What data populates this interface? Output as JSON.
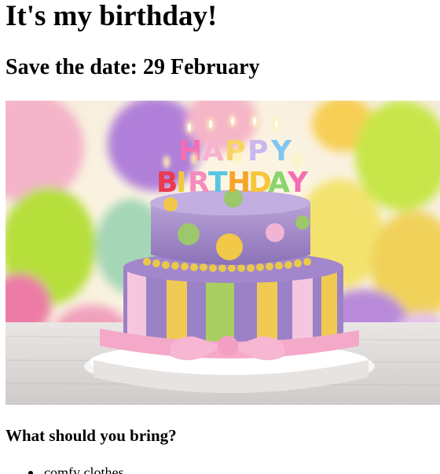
{
  "page": {
    "title": "It's my birthday!",
    "subtitle": "Save the date: 29 February",
    "image_alt": "Birthday cake with Happy Birthday candles",
    "cake_candle_letters": "HAPPY BIRTHDAY",
    "bring_heading": "What should you bring?",
    "bring_items": [
      "comfy clothes"
    ]
  }
}
